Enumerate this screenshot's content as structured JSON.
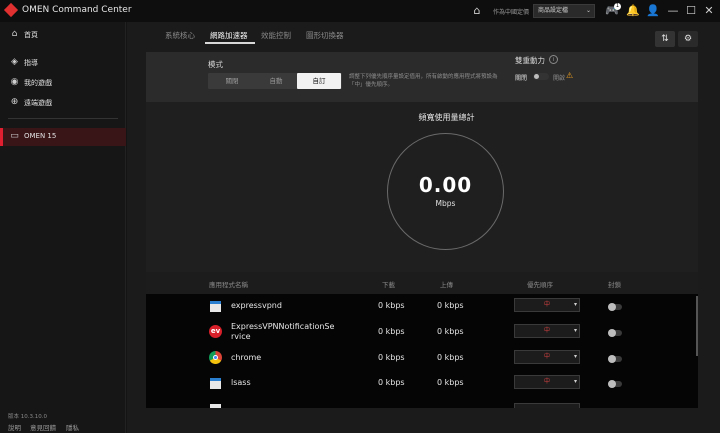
{
  "window": {
    "title": "OMEN Command Center"
  },
  "titlebar": {
    "region_label": "作為中國定價",
    "region_value": "商品設定檔",
    "gamepad_badge": "1"
  },
  "sidebar": {
    "items": [
      {
        "label": "首頁",
        "icon": "home-icon"
      },
      {
        "label": "指導",
        "icon": "guide-icon"
      },
      {
        "label": "我的遊戲",
        "icon": "gamepad-icon"
      },
      {
        "label": "遠端遊戲",
        "icon": "remote-play-icon"
      }
    ],
    "device": "OMEN 15",
    "version": "版本 10.3.10.0",
    "footer": {
      "help": "說明",
      "feedback": "意見回饋",
      "privacy": "隱私"
    }
  },
  "tabs": [
    {
      "label": "系統核心"
    },
    {
      "label": "網路加速器"
    },
    {
      "label": "效能控制"
    },
    {
      "label": "圖形切換器"
    }
  ],
  "mode": {
    "label": "模式",
    "options": [
      "關閉",
      "自動",
      "自訂"
    ],
    "selected": "自訂",
    "description": "調整下列優先順序量設定值用，所有啟動的應用程式將預設為「中」優先順序。"
  },
  "dual_power": {
    "label": "雙重動力",
    "off_label": "關閉",
    "on_label": "開啟",
    "state": "off"
  },
  "bandwidth": {
    "title": "頻寬使用量總計",
    "value": "0.00",
    "unit": "Mbps"
  },
  "table": {
    "headers": {
      "name": "應用程式名稱",
      "download": "下載",
      "upload": "上傳",
      "priority": "優先順序",
      "block": "封鎖"
    },
    "rows": [
      {
        "name": "expressvpnd",
        "icon": "expressvpn-window-icon",
        "download": "0 kbps",
        "upload": "0 kbps",
        "priority": "中"
      },
      {
        "name": "ExpressVPNNotificationSe",
        "name2": "rvice",
        "icon": "expressvpn-logo-icon",
        "download": "0 kbps",
        "upload": "0 kbps",
        "priority": "中"
      },
      {
        "name": "chrome",
        "icon": "chrome-icon",
        "download": "0 kbps",
        "upload": "0 kbps",
        "priority": "中"
      },
      {
        "name": "lsass",
        "icon": "lsass-window-icon",
        "download": "0 kbps",
        "upload": "0 kbps",
        "priority": "中"
      }
    ]
  },
  "colors": {
    "accent": "#e02030",
    "background": "#141414",
    "priority_text": "#d04040",
    "warning": "#f0a020"
  }
}
